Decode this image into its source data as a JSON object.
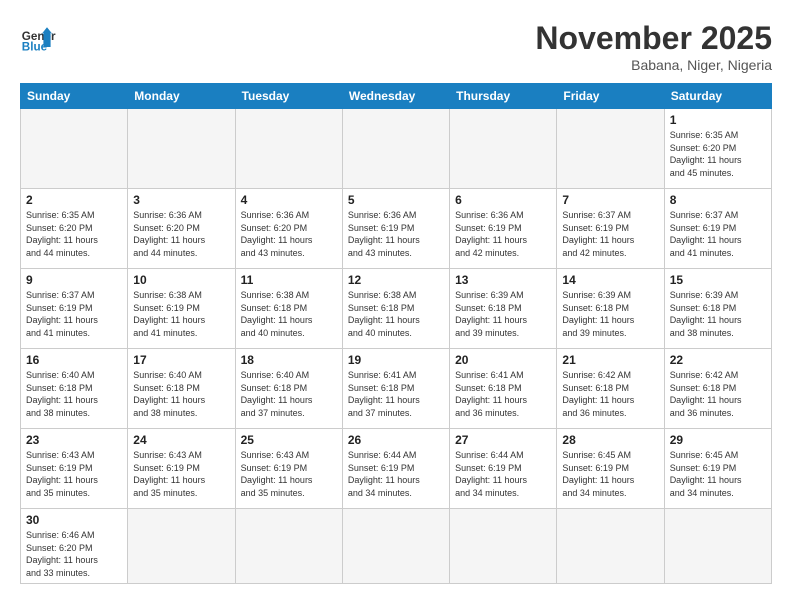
{
  "header": {
    "logo_general": "General",
    "logo_blue": "Blue",
    "month_title": "November 2025",
    "location": "Babana, Niger, Nigeria"
  },
  "weekdays": [
    "Sunday",
    "Monday",
    "Tuesday",
    "Wednesday",
    "Thursday",
    "Friday",
    "Saturday"
  ],
  "weeks": [
    [
      {
        "day": "",
        "info": ""
      },
      {
        "day": "",
        "info": ""
      },
      {
        "day": "",
        "info": ""
      },
      {
        "day": "",
        "info": ""
      },
      {
        "day": "",
        "info": ""
      },
      {
        "day": "",
        "info": ""
      },
      {
        "day": "1",
        "info": "Sunrise: 6:35 AM\nSunset: 6:20 PM\nDaylight: 11 hours\nand 45 minutes."
      }
    ],
    [
      {
        "day": "2",
        "info": "Sunrise: 6:35 AM\nSunset: 6:20 PM\nDaylight: 11 hours\nand 44 minutes."
      },
      {
        "day": "3",
        "info": "Sunrise: 6:36 AM\nSunset: 6:20 PM\nDaylight: 11 hours\nand 44 minutes."
      },
      {
        "day": "4",
        "info": "Sunrise: 6:36 AM\nSunset: 6:20 PM\nDaylight: 11 hours\nand 43 minutes."
      },
      {
        "day": "5",
        "info": "Sunrise: 6:36 AM\nSunset: 6:19 PM\nDaylight: 11 hours\nand 43 minutes."
      },
      {
        "day": "6",
        "info": "Sunrise: 6:36 AM\nSunset: 6:19 PM\nDaylight: 11 hours\nand 42 minutes."
      },
      {
        "day": "7",
        "info": "Sunrise: 6:37 AM\nSunset: 6:19 PM\nDaylight: 11 hours\nand 42 minutes."
      },
      {
        "day": "8",
        "info": "Sunrise: 6:37 AM\nSunset: 6:19 PM\nDaylight: 11 hours\nand 41 minutes."
      }
    ],
    [
      {
        "day": "9",
        "info": "Sunrise: 6:37 AM\nSunset: 6:19 PM\nDaylight: 11 hours\nand 41 minutes."
      },
      {
        "day": "10",
        "info": "Sunrise: 6:38 AM\nSunset: 6:19 PM\nDaylight: 11 hours\nand 41 minutes."
      },
      {
        "day": "11",
        "info": "Sunrise: 6:38 AM\nSunset: 6:18 PM\nDaylight: 11 hours\nand 40 minutes."
      },
      {
        "day": "12",
        "info": "Sunrise: 6:38 AM\nSunset: 6:18 PM\nDaylight: 11 hours\nand 40 minutes."
      },
      {
        "day": "13",
        "info": "Sunrise: 6:39 AM\nSunset: 6:18 PM\nDaylight: 11 hours\nand 39 minutes."
      },
      {
        "day": "14",
        "info": "Sunrise: 6:39 AM\nSunset: 6:18 PM\nDaylight: 11 hours\nand 39 minutes."
      },
      {
        "day": "15",
        "info": "Sunrise: 6:39 AM\nSunset: 6:18 PM\nDaylight: 11 hours\nand 38 minutes."
      }
    ],
    [
      {
        "day": "16",
        "info": "Sunrise: 6:40 AM\nSunset: 6:18 PM\nDaylight: 11 hours\nand 38 minutes."
      },
      {
        "day": "17",
        "info": "Sunrise: 6:40 AM\nSunset: 6:18 PM\nDaylight: 11 hours\nand 38 minutes."
      },
      {
        "day": "18",
        "info": "Sunrise: 6:40 AM\nSunset: 6:18 PM\nDaylight: 11 hours\nand 37 minutes."
      },
      {
        "day": "19",
        "info": "Sunrise: 6:41 AM\nSunset: 6:18 PM\nDaylight: 11 hours\nand 37 minutes."
      },
      {
        "day": "20",
        "info": "Sunrise: 6:41 AM\nSunset: 6:18 PM\nDaylight: 11 hours\nand 36 minutes."
      },
      {
        "day": "21",
        "info": "Sunrise: 6:42 AM\nSunset: 6:18 PM\nDaylight: 11 hours\nand 36 minutes."
      },
      {
        "day": "22",
        "info": "Sunrise: 6:42 AM\nSunset: 6:18 PM\nDaylight: 11 hours\nand 36 minutes."
      }
    ],
    [
      {
        "day": "23",
        "info": "Sunrise: 6:43 AM\nSunset: 6:19 PM\nDaylight: 11 hours\nand 35 minutes."
      },
      {
        "day": "24",
        "info": "Sunrise: 6:43 AM\nSunset: 6:19 PM\nDaylight: 11 hours\nand 35 minutes."
      },
      {
        "day": "25",
        "info": "Sunrise: 6:43 AM\nSunset: 6:19 PM\nDaylight: 11 hours\nand 35 minutes."
      },
      {
        "day": "26",
        "info": "Sunrise: 6:44 AM\nSunset: 6:19 PM\nDaylight: 11 hours\nand 34 minutes."
      },
      {
        "day": "27",
        "info": "Sunrise: 6:44 AM\nSunset: 6:19 PM\nDaylight: 11 hours\nand 34 minutes."
      },
      {
        "day": "28",
        "info": "Sunrise: 6:45 AM\nSunset: 6:19 PM\nDaylight: 11 hours\nand 34 minutes."
      },
      {
        "day": "29",
        "info": "Sunrise: 6:45 AM\nSunset: 6:19 PM\nDaylight: 11 hours\nand 34 minutes."
      }
    ],
    [
      {
        "day": "30",
        "info": "Sunrise: 6:46 AM\nSunset: 6:20 PM\nDaylight: 11 hours\nand 33 minutes."
      },
      {
        "day": "",
        "info": ""
      },
      {
        "day": "",
        "info": ""
      },
      {
        "day": "",
        "info": ""
      },
      {
        "day": "",
        "info": ""
      },
      {
        "day": "",
        "info": ""
      },
      {
        "day": "",
        "info": ""
      }
    ]
  ]
}
